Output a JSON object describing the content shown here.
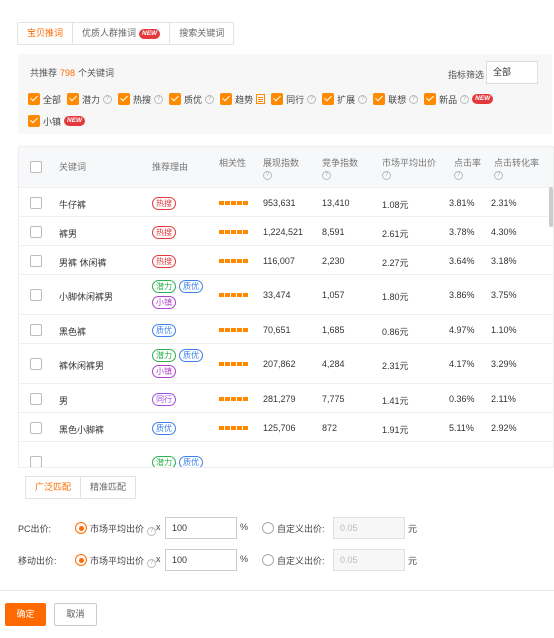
{
  "tabs": [
    {
      "label": "宝贝推词",
      "active": true
    },
    {
      "label": "优质人群推词",
      "badge": "NEW"
    },
    {
      "label": "搜索关键词"
    }
  ],
  "filter": {
    "count_prefix": "共推荐",
    "count": "798",
    "count_suffix": "个关键词",
    "metric_label": "指标筛选",
    "metric_value": "全部",
    "checks": [
      {
        "label": "全部",
        "help": false
      },
      {
        "label": "潜力",
        "help": true
      },
      {
        "label": "热搜",
        "help": true
      },
      {
        "label": "质优",
        "help": true
      },
      {
        "label": "趋势",
        "doc": true
      },
      {
        "label": "同行",
        "help": true
      },
      {
        "label": "扩展",
        "help": true
      },
      {
        "label": "联想",
        "help": true
      },
      {
        "label": "新品",
        "help": true,
        "badge": "NEW"
      },
      {
        "label": "小镇",
        "badge": "NEW"
      }
    ]
  },
  "table": {
    "headers": {
      "keyword": "关键词",
      "reason": "推荐理由",
      "relevance": "相关性",
      "impressions": "展现指数",
      "competition": "竞争指数",
      "avg_bid": "市场平均出价",
      "ctr": "点击率",
      "cvr": "点击转化率"
    },
    "rows": [
      {
        "keyword": "牛仔裤",
        "tags": [
          {
            "t": "热搜",
            "k": "hot"
          }
        ],
        "impressions": "953,631",
        "competition": "13,410",
        "avg_bid": "1.08元",
        "ctr": "3.81%",
        "cvr": "2.31%"
      },
      {
        "keyword": "裤男",
        "tags": [
          {
            "t": "热搜",
            "k": "hot"
          }
        ],
        "impressions": "1,224,521",
        "competition": "8,591",
        "avg_bid": "2.61元",
        "ctr": "3.78%",
        "cvr": "4.30%"
      },
      {
        "keyword": "男裤 休闲裤",
        "tags": [
          {
            "t": "热搜",
            "k": "hot"
          }
        ],
        "impressions": "116,007",
        "competition": "2,230",
        "avg_bid": "2.27元",
        "ctr": "3.64%",
        "cvr": "3.18%"
      },
      {
        "keyword": "小脚休闲裤男",
        "tags": [
          {
            "t": "潜力",
            "k": "pot"
          },
          {
            "t": "质优",
            "k": "qual"
          },
          {
            "t": "小镇",
            "k": "small"
          }
        ],
        "impressions": "33,474",
        "competition": "1,057",
        "avg_bid": "1.80元",
        "ctr": "3.86%",
        "cvr": "3.75%"
      },
      {
        "keyword": "黑色裤",
        "tags": [
          {
            "t": "质优",
            "k": "qual"
          }
        ],
        "impressions": "70,651",
        "competition": "1,685",
        "avg_bid": "0.86元",
        "ctr": "4.97%",
        "cvr": "1.10%"
      },
      {
        "keyword": "裤休闲裤男",
        "tags": [
          {
            "t": "潜力",
            "k": "pot"
          },
          {
            "t": "质优",
            "k": "qual"
          },
          {
            "t": "小镇",
            "k": "small"
          }
        ],
        "impressions": "207,862",
        "competition": "4,284",
        "avg_bid": "2.31元",
        "ctr": "4.17%",
        "cvr": "3.29%"
      },
      {
        "keyword": "男",
        "tags": [
          {
            "t": "同行",
            "k": "peer"
          }
        ],
        "impressions": "281,279",
        "competition": "7,775",
        "avg_bid": "1.41元",
        "ctr": "0.36%",
        "cvr": "2.11%"
      },
      {
        "keyword": "黑色小脚裤",
        "tags": [
          {
            "t": "质优",
            "k": "qual"
          }
        ],
        "impressions": "125,706",
        "competition": "872",
        "avg_bid": "1.91元",
        "ctr": "5.11%",
        "cvr": "2.92%"
      },
      {
        "keyword": "",
        "tags": [
          {
            "t": "潜力",
            "k": "pot"
          },
          {
            "t": "质优",
            "k": "qual"
          }
        ],
        "impressions": "",
        "competition": "",
        "avg_bid": "",
        "ctr": "",
        "cvr": ""
      }
    ]
  },
  "match_tabs": [
    "广泛匹配",
    "精准匹配"
  ],
  "bids": [
    {
      "label": "PC出价:",
      "market_label": "市场平均出价",
      "multiply": "x",
      "value": "100",
      "unit": "%",
      "custom_label": "自定义出价:",
      "custom_placeholder": "0.05",
      "currency": "元"
    },
    {
      "label": "移动出价:",
      "market_label": "市场平均出价",
      "multiply": "x",
      "value": "100",
      "unit": "%",
      "custom_label": "自定义出价:",
      "custom_placeholder": "0.05",
      "currency": "元"
    }
  ],
  "footer": {
    "ok": "确定",
    "cancel": "取消"
  },
  "colors": {
    "accent": "#ff6a00",
    "hot": "#e4393c",
    "potential": "#2bb24c",
    "quality": "#3c82f0"
  }
}
